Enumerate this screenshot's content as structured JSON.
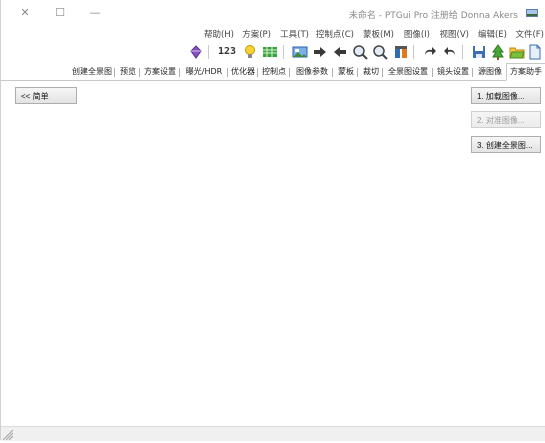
{
  "window": {
    "title": "未命名 - PTGui Pro 注册给 Donna Akers",
    "controls": {
      "minimize": "—",
      "maximize": "☐",
      "close": "✕"
    }
  },
  "menu": {
    "items": [
      "文件(F)",
      "编辑(E)",
      "视图(V)",
      "图像(I)",
      "蒙板(M)",
      "控制点(C)",
      "工具(T)",
      "方案(P)",
      "帮助(H)"
    ]
  },
  "toolbar": {
    "zoom_label": "123",
    "icons": [
      "new-document-icon",
      "open-folder-icon",
      "tree-icon",
      "save-icon",
      "undo-icon",
      "redo-icon",
      "control-point-icon",
      "zoom-in-icon",
      "zoom-out-icon",
      "arrow-left-icon",
      "arrow-right-icon",
      "image-icon",
      "table-icon",
      "lightbulb-icon",
      "zoom-label",
      "gem-icon"
    ]
  },
  "tabs": {
    "active": "方案助手",
    "items": [
      "方案助手",
      "源图像",
      "镜头设置",
      "全景图设置",
      "裁切",
      "蒙板",
      "图像参数",
      "控制点",
      "优化器",
      "曝光/HDR",
      "方案设置",
      "预览",
      "创建全景图"
    ]
  },
  "assistant": {
    "load_images_button": "1. 加载图像...",
    "align_images_button": "2. 对准图像...",
    "create_panorama_button": "3. 创建全景图...",
    "simple_button": "<< 简单"
  },
  "colors": {
    "accent_blue": "#2b5fb4",
    "disabled_text": "#9a9a9a"
  }
}
